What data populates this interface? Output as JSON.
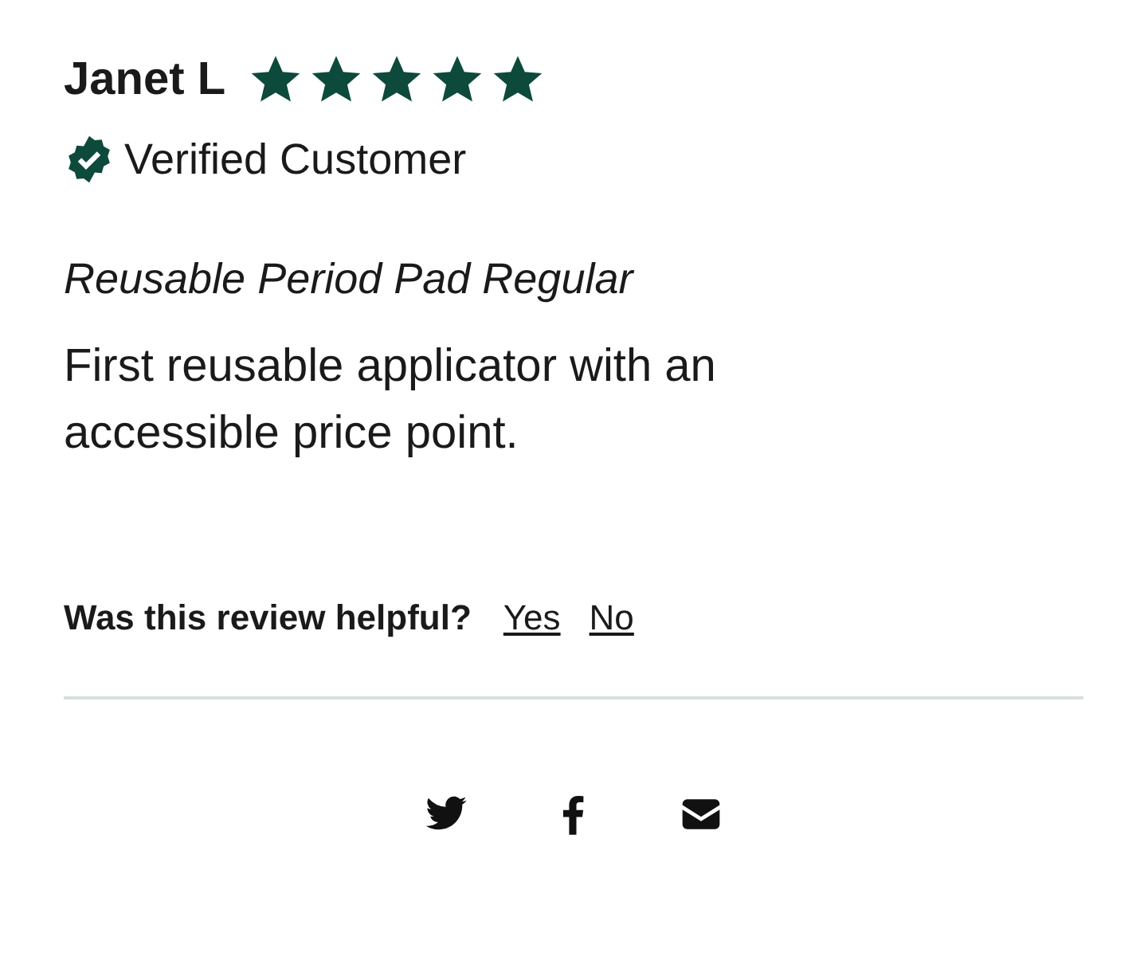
{
  "review": {
    "author": "Janet L",
    "stars": 5,
    "verified_label": "Verified Customer",
    "product": "Reusable Period Pad Regular",
    "body": "First reusable applicator with an accessible price point."
  },
  "helpful": {
    "question": "Was this review helpful?",
    "yes": "Yes",
    "no": "No"
  },
  "share": [
    {
      "kind": "twitter"
    },
    {
      "kind": "facebook"
    },
    {
      "kind": "email"
    }
  ]
}
